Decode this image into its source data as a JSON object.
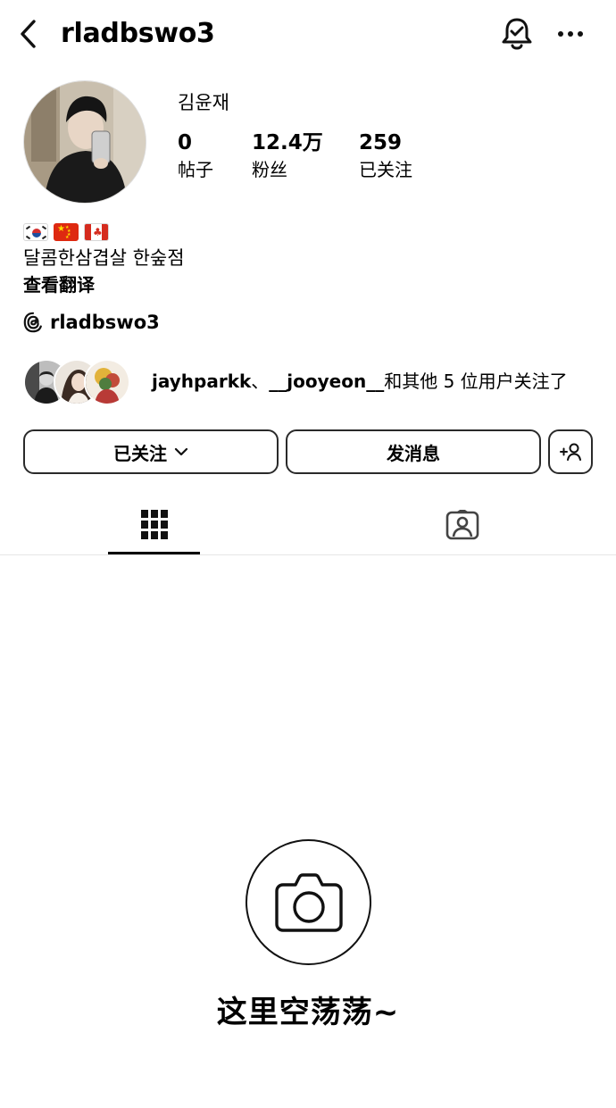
{
  "header": {
    "username": "rladbswo3",
    "back_icon": "chevron-left-icon",
    "notify_icon": "bell-check-icon",
    "more_icon": "more-horizontal-icon"
  },
  "profile": {
    "display_name": "김윤재",
    "stats": [
      {
        "value": "0",
        "label": "帖子"
      },
      {
        "value": "12.4万",
        "label": "粉丝"
      },
      {
        "value": "259",
        "label": "已关注"
      }
    ],
    "flags": [
      "south-korea-flag-icon",
      "china-flag-icon",
      "canada-flag-icon"
    ],
    "bio": "달콤한삼겹살 한숲점",
    "translate_label": "查看翻译",
    "threads_handle": "rladbswo3"
  },
  "mutuals": {
    "user1": "jayhparkk",
    "sep": "、",
    "user2": "__jooyeon__",
    "suffix": "和其他 5 位用户关注了"
  },
  "actions": {
    "following_label": "已关注",
    "message_label": "发消息",
    "add_user_icon": "add-user-icon"
  },
  "tabs": {
    "grid_icon": "grid-icon",
    "tagged_icon": "tagged-user-icon",
    "active": "grid"
  },
  "empty_state": {
    "icon": "camera-icon",
    "text": "这里空荡荡~"
  },
  "colors": {
    "text": "#000000",
    "border": "#2a2a2a",
    "divider": "#e6e6e6",
    "background": "#ffffff"
  }
}
